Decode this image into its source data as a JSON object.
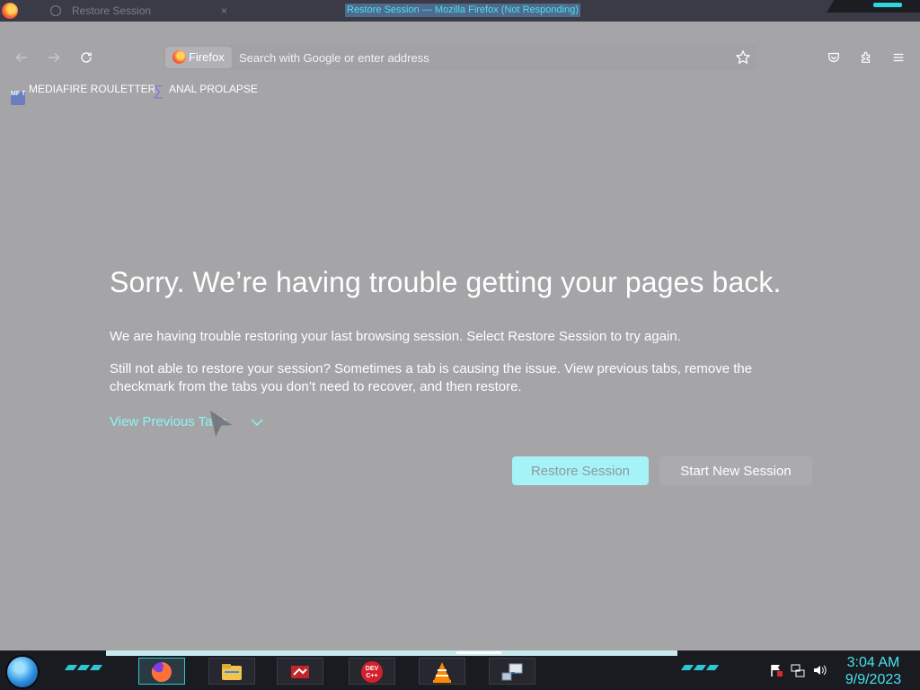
{
  "window": {
    "title": "Restore Session — Mozilla Firefox (Not Responding)",
    "tab_label": "Restore Session",
    "tab_close": "×"
  },
  "toolbar": {
    "identity_label": "Firefox",
    "url_placeholder": "Search with Google or enter address"
  },
  "bookmarks": [
    {
      "label": "MEDIAFIRE ROULETTER",
      "icon": "mediafire-icon",
      "icon_text": "MF T"
    },
    {
      "label": "ANAL PROLAPSE",
      "icon": "sigma-icon",
      "icon_text": "∑"
    }
  ],
  "content": {
    "heading": "Sorry. We’re having trouble getting your pages back.",
    "para1": "We are having trouble restoring your last browsing session. Select Restore Session to try again.",
    "para2": "Still not able to restore your session? Sometimes a tab is causing the issue. View previous tabs, remove the checkmark from the tabs you don’t need to recover, and then restore.",
    "view_previous_label": "View Previous Tabs",
    "restore_label": "Restore Session",
    "new_session_label": "Start New Session"
  },
  "taskbar": {
    "apps": [
      {
        "name": "firefox-task",
        "icon": "firefox-icon",
        "active": true
      },
      {
        "name": "file-explorer-task",
        "icon": "folder-icon",
        "active": false
      },
      {
        "name": "app3-task",
        "icon": "app-icon",
        "active": false
      },
      {
        "name": "devcpp-task",
        "icon": "devcpp-icon",
        "active": false
      },
      {
        "name": "vlc-task",
        "icon": "vlc-icon",
        "active": false
      },
      {
        "name": "network-tool-task",
        "icon": "network-icon",
        "active": false
      }
    ],
    "devcpp_text": "DEV C++",
    "time": "3:04 AM",
    "date": "9/9/2023"
  },
  "colors": {
    "accent_cyan": "#48e2ee",
    "link_cyan": "#8df2f6",
    "restore_button_bg": "#a6f3f7",
    "overlay_gray": "#a5a5a8"
  }
}
